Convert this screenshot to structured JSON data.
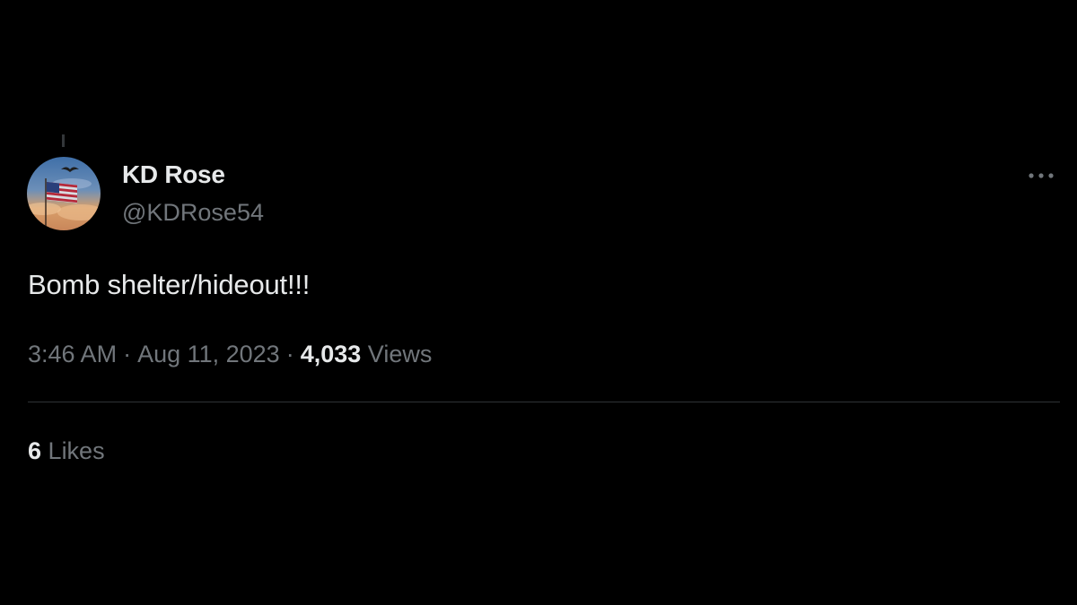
{
  "tweet": {
    "author": {
      "display_name": "KD Rose",
      "handle": "@KDRose54",
      "avatar_icon": "flag-avatar-icon"
    },
    "text": "Bomb shelter/hideout!!!",
    "time": "3:46 AM",
    "separator": "·",
    "date": "Aug 11, 2023",
    "views_count": "4,033",
    "views_label": "Views",
    "likes_count": "6",
    "likes_label": "Likes",
    "more_icon": "more-dots-icon"
  },
  "colors": {
    "background": "#000000",
    "primary_text": "#e7e9ea",
    "secondary_text": "#71767b",
    "divider": "#2f3336"
  }
}
